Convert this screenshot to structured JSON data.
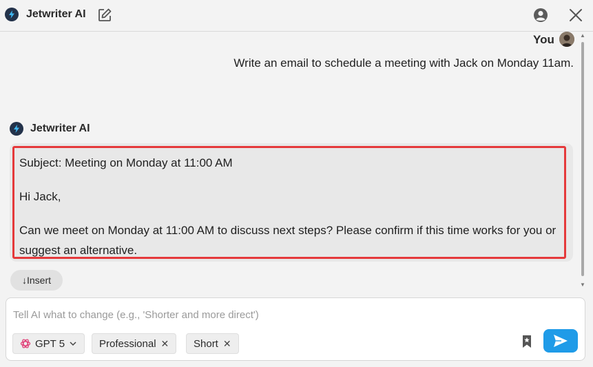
{
  "header": {
    "title": "Jetwriter AI",
    "icons": [
      "bolt-logo-icon",
      "edit-icon",
      "account-icon",
      "close-icon"
    ]
  },
  "conversation": {
    "user": {
      "label": "You",
      "message": "Write an email to schedule a meeting with Jack on Monday 11am."
    },
    "assistant": {
      "name": "Jetwriter AI",
      "lines": [
        "Subject: Meeting on Monday at 11:00 AM",
        "Hi Jack,",
        "Can we meet on Monday at 11:00 AM to discuss next steps? Please confirm if this time works for you or suggest an alternative."
      ],
      "highlight_color": "#e5393b"
    },
    "insert_label": "↓Insert"
  },
  "composer": {
    "placeholder": "Tell AI what to change (e.g., 'Shorter and more direct')",
    "value": "",
    "model": "GPT 5",
    "chips": [
      "Professional",
      "Short"
    ],
    "send_color": "#1f9be8"
  }
}
